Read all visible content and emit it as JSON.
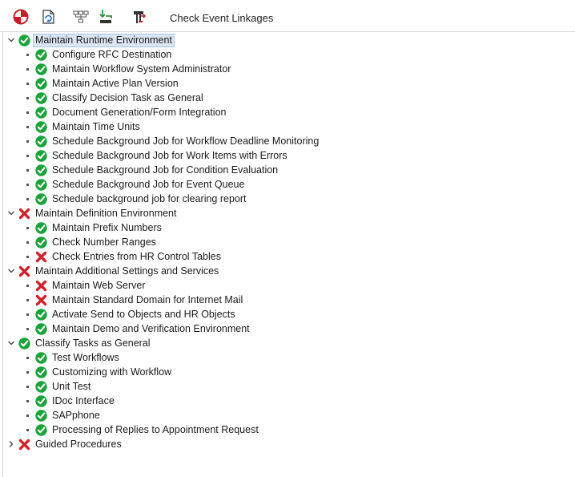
{
  "toolbar": {
    "check_event_linkages_label": "Check Event Linkages"
  },
  "colors": {
    "ok": "#19a33a",
    "error": "#d4202a",
    "selection": "#dbe6f3"
  },
  "tree": [
    {
      "label": "Maintain Runtime Environment",
      "status": "ok",
      "level": 0,
      "expanded": true,
      "selected": true
    },
    {
      "label": "Configure RFC Destination",
      "status": "ok",
      "level": 1
    },
    {
      "label": "Maintain Workflow System Administrator",
      "status": "ok",
      "level": 1
    },
    {
      "label": "Maintain Active Plan Version",
      "status": "ok",
      "level": 1
    },
    {
      "label": "Classify Decision Task as General",
      "status": "ok",
      "level": 1
    },
    {
      "label": "Document Generation/Form Integration",
      "status": "ok",
      "level": 1
    },
    {
      "label": "Maintain Time Units",
      "status": "ok",
      "level": 1
    },
    {
      "label": "Schedule Background Job for Workflow Deadline Monitoring",
      "status": "ok",
      "level": 1
    },
    {
      "label": "Schedule Background Job for Work Items with Errors",
      "status": "ok",
      "level": 1
    },
    {
      "label": "Schedule Background Job for Condition Evaluation",
      "status": "ok",
      "level": 1
    },
    {
      "label": "Schedule Background Job for Event Queue",
      "status": "ok",
      "level": 1
    },
    {
      "label": "Schedule background job for clearing report",
      "status": "ok",
      "level": 1
    },
    {
      "label": "Maintain Definition Environment",
      "status": "error",
      "level": 0,
      "expanded": true
    },
    {
      "label": "Maintain Prefix Numbers",
      "status": "ok",
      "level": 1
    },
    {
      "label": "Check Number Ranges",
      "status": "ok",
      "level": 1
    },
    {
      "label": "Check Entries from HR Control Tables",
      "status": "error",
      "level": 1
    },
    {
      "label": "Maintain Additional Settings and Services",
      "status": "error",
      "level": 0,
      "expanded": true
    },
    {
      "label": "Maintain Web Server",
      "status": "error",
      "level": 1
    },
    {
      "label": "Maintain Standard Domain for Internet Mail",
      "status": "error",
      "level": 1
    },
    {
      "label": "Activate Send to Objects and HR Objects",
      "status": "ok",
      "level": 1
    },
    {
      "label": "Maintain Demo and Verification Environment",
      "status": "ok",
      "level": 1
    },
    {
      "label": "Classify Tasks as General",
      "status": "ok",
      "level": 0,
      "expanded": true
    },
    {
      "label": "Test Workflows",
      "status": "ok",
      "level": 1
    },
    {
      "label": "Customizing with Workflow",
      "status": "ok",
      "level": 1
    },
    {
      "label": "Unit Test",
      "status": "ok",
      "level": 1
    },
    {
      "label": "IDoc Interface",
      "status": "ok",
      "level": 1
    },
    {
      "label": "SAPphone",
      "status": "ok",
      "level": 1
    },
    {
      "label": "Processing of Replies to Appointment Request",
      "status": "ok",
      "level": 1
    },
    {
      "label": "Guided Procedures",
      "status": "error",
      "level": 0,
      "expanded": false
    }
  ]
}
